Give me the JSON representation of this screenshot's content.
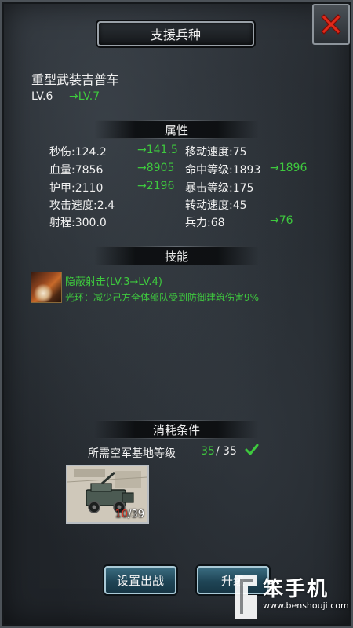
{
  "window": {
    "title": "支援兵种"
  },
  "unit": {
    "name": "重型武装吉普车",
    "level": "LV.6",
    "next_level": "→LV.7"
  },
  "sections": {
    "attributes": "属性",
    "skills": "技能",
    "cost": "消耗条件"
  },
  "stats": {
    "dps": "秒伤:124.2",
    "dps_next": "→141.5",
    "move_speed": "移动速度:75",
    "hp": "血量:7856",
    "hp_next": "→8905",
    "hit_level": "命中等级:1893",
    "hit_level_next": "→1896",
    "armor": "护甲:2110",
    "armor_next": "→2196",
    "crit_level": "暴击等级:175",
    "attack_speed": "攻击速度:2.4",
    "turn_speed": "转动速度:45",
    "range": "射程:300.0",
    "troops": "兵力:68",
    "troops_next": "→76"
  },
  "skill": {
    "name": "隐蔽射击(LV.3→LV.4)",
    "description": "光环：减少己方全体部队受到防御建筑伤害9%",
    "icon": "skill-icon"
  },
  "requirement": {
    "label": "所需空军基地等级",
    "have": "35",
    "separator": "/",
    "need": "35"
  },
  "material_card": {
    "have": "10",
    "separator": "/",
    "need": "39"
  },
  "buttons": {
    "deploy": "设置出战",
    "upgrade": "升级"
  },
  "watermark": {
    "brand": "笨手机",
    "url": "www.benshouji.com"
  },
  "colors": {
    "green": "#3ec93e",
    "red": "#e03a2a",
    "close_red": "#e02a1a"
  }
}
